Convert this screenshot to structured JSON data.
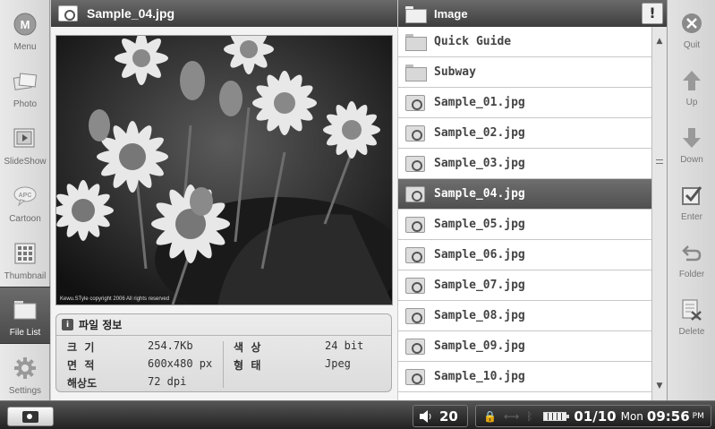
{
  "left_menu": [
    {
      "label": "Menu",
      "icon": "m-circle-icon"
    },
    {
      "label": "Photo",
      "icon": "photo-frames-icon"
    },
    {
      "label": "SlideShow",
      "icon": "slideshow-icon"
    },
    {
      "label": "Cartoon",
      "icon": "cartoon-bubble-icon"
    },
    {
      "label": "Thumbnail",
      "icon": "thumbnail-grid-icon"
    },
    {
      "label": "File List",
      "icon": "folder-icon",
      "active": true
    },
    {
      "label": "Settings",
      "icon": "gear-icon"
    }
  ],
  "viewer": {
    "title": "Sample_04.jpg",
    "photo_caption": "Kewu.STyle  copyright 2006 All rights reserved",
    "info": {
      "heading": "파일 정보",
      "size_label": "크  기",
      "size_value": "254.7Kb",
      "dimensions_label": "면  적",
      "dimensions_value": "600x480 px",
      "resolution_label": "해상도",
      "resolution_value": "72 dpi",
      "color_label": "색  상",
      "color_value": "24 bit",
      "format_label": "형  태",
      "format_value": "Jpeg"
    }
  },
  "file_list": {
    "title": "Image",
    "info_button": "!",
    "items": [
      {
        "name": "Quick Guide",
        "type": "folder"
      },
      {
        "name": "Subway",
        "type": "folder"
      },
      {
        "name": "Sample_01.jpg",
        "type": "image"
      },
      {
        "name": "Sample_02.jpg",
        "type": "image"
      },
      {
        "name": "Sample_03.jpg",
        "type": "image"
      },
      {
        "name": "Sample_04.jpg",
        "type": "image",
        "selected": true
      },
      {
        "name": "Sample_05.jpg",
        "type": "image"
      },
      {
        "name": "Sample_06.jpg",
        "type": "image"
      },
      {
        "name": "Sample_07.jpg",
        "type": "image"
      },
      {
        "name": "Sample_08.jpg",
        "type": "image"
      },
      {
        "name": "Sample_09.jpg",
        "type": "image"
      },
      {
        "name": "Sample_10.jpg",
        "type": "image"
      }
    ]
  },
  "right_menu": [
    {
      "label": "Quit",
      "icon": "close-icon"
    },
    {
      "label": "Up",
      "icon": "arrow-up-icon"
    },
    {
      "label": "Down",
      "icon": "arrow-down-icon"
    },
    {
      "label": "Enter",
      "icon": "checkbox-icon"
    },
    {
      "label": "Folder",
      "icon": "return-arrow-icon"
    },
    {
      "label": "Delete",
      "icon": "delete-document-icon"
    }
  ],
  "status_bar": {
    "volume": "20",
    "date": "01/10",
    "day": "Mon",
    "time": "09:56",
    "ampm": "PM"
  },
  "colors": {
    "selected_row": "#5c5c5c",
    "title_bar": "#4a4a4a",
    "sidebar_bg": "#dcdcdc"
  }
}
